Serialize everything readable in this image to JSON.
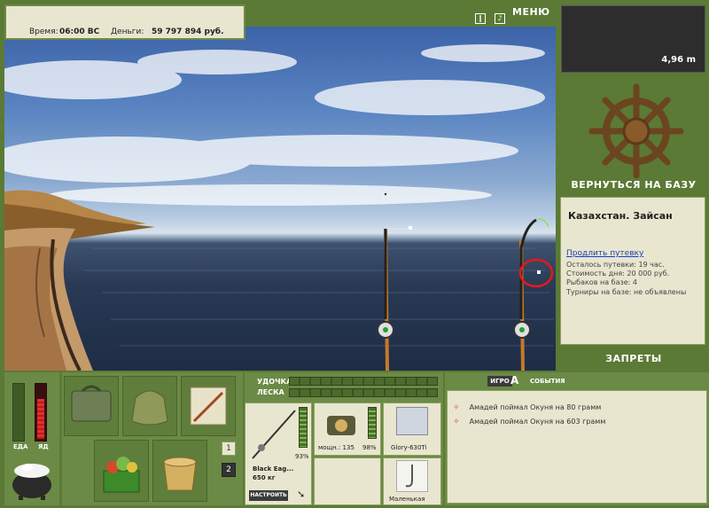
{
  "header": {
    "time_label": "Время:",
    "time_value": "06:00 ВС",
    "money_label": "Деньги:",
    "money_value": "59 797 894 руб.",
    "menu_label": "МЕНЮ"
  },
  "right_panel": {
    "depth_value": "4,96 m",
    "return_button": "ВЕРНУТЬСЯ НА БАЗУ",
    "location_title": "Казахстан. Зайсан",
    "extend_link": "Продлить путевку",
    "lines": [
      "Осталось путевки: 19 час.",
      "Стоимость дня: 20 000 руб.",
      "Рыбаков на базе: 4",
      "Турниры на базе: не объявлены"
    ],
    "bans_button": "ЗАПРЕТЫ"
  },
  "meters": {
    "food_label": "ЕДА",
    "poison_label": "ЯД",
    "food_level": 0.0,
    "poison_level": 0.75
  },
  "page_buttons": [
    "1",
    "2"
  ],
  "gear": {
    "rod_label": "УДОЧКА",
    "line_label": "ЛЕСКА",
    "rod_name": "Black Eag...",
    "rod_weight": "650 кг",
    "rod_percent": "93%",
    "reel_power": "мощн.: 135",
    "reel_percent": "98%",
    "line_name": "Glory-630Ti",
    "hook_name": "Маленькая",
    "adjust_button": "НАСТРОИТЬ"
  },
  "events": {
    "tab_game": "ИГРО",
    "tab_events": "СОБЫТИЯ",
    "items": [
      "Амадей поймал Окуня на 80 грамм",
      "Амадей поймал Окуня на 603 грамм"
    ]
  },
  "colors": {
    "frame_green": "#5b7a35",
    "panel_light": "#e9e6cf",
    "link_blue": "#1a3fbf"
  }
}
